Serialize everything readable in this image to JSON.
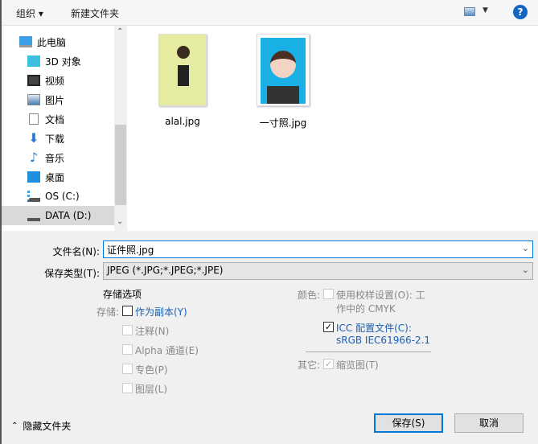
{
  "toolbar": {
    "organize": "组织 ▾",
    "new_folder": "新建文件夹",
    "view_icon": "view-icon",
    "help": "?"
  },
  "nav": {
    "items": [
      {
        "label": "此电脑",
        "icon": "computer-icon"
      },
      {
        "label": "3D 对象",
        "icon": "cube-icon"
      },
      {
        "label": "视频",
        "icon": "video-icon"
      },
      {
        "label": "图片",
        "icon": "picture-icon"
      },
      {
        "label": "文档",
        "icon": "document-icon"
      },
      {
        "label": "下载",
        "icon": "download-icon"
      },
      {
        "label": "音乐",
        "icon": "music-icon"
      },
      {
        "label": "桌面",
        "icon": "desktop-icon"
      },
      {
        "label": "OS (C:)",
        "icon": "drive-icon"
      },
      {
        "label": "DATA (D:)",
        "icon": "drive-icon"
      }
    ]
  },
  "files": [
    {
      "name": "alal.jpg"
    },
    {
      "name": "一寸照.jpg"
    }
  ],
  "form": {
    "filename_label": "文件名(N):",
    "filename_value": "证件照.jpg",
    "type_label": "保存类型(T):",
    "type_value": "JPEG (*.JPG;*.JPEG;*.JPE)"
  },
  "options": {
    "title": "存储选项",
    "save_label": "存储:",
    "as_copy": "作为副本(Y)",
    "notes": "注释(N)",
    "alpha": "Alpha 通道(E)",
    "spot": "专色(P)",
    "layers": "图层(L)",
    "color_label": "颜色:",
    "proof_line1": "使用校样设置(O): 工",
    "proof_line2": "作中的 CMYK",
    "icc_line1": "ICC 配置文件(C):",
    "icc_line2": "sRGB IEC61966-2.1",
    "other_label": "其它:",
    "thumbnail": "缩览图(T)"
  },
  "footer": {
    "hide_folders": "隐藏文件夹",
    "save": "保存(S)",
    "cancel": "取消"
  }
}
